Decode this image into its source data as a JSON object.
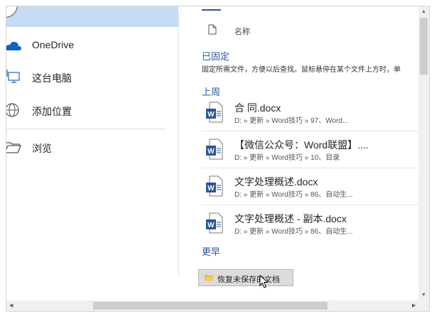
{
  "nav": {
    "items": [
      {
        "label": "OneDrive",
        "icon": "cloud-icon"
      },
      {
        "label": "这台电脑",
        "icon": "computer-icon"
      },
      {
        "label": "添加位置",
        "icon": "globe-icon"
      },
      {
        "label": "浏览",
        "icon": "folder-icon"
      }
    ]
  },
  "list": {
    "header_name": "名称",
    "pinned_title": "已固定",
    "pinned_desc": "固定所需文件，方便以后查找。鼠标悬停在某个文件上方时，单",
    "last_week_title": "上周",
    "older_title": "更早",
    "files": [
      {
        "title": "合 同.docx",
        "path": "D: » 更新 » Word技巧 » 97、Word..."
      },
      {
        "title": "【微信公众号：Word联盟】....",
        "path": "D: » 更新 » Word技巧 » 10、目录"
      },
      {
        "title": "文字处理概述.docx",
        "path": "D: » 更新 » Word技巧 » 86、自动生..."
      },
      {
        "title": "文字处理概述 - 副本.docx",
        "path": "D: » 更新 » Word技巧 » 86、自动生..."
      }
    ],
    "recover_button": "恢复未保存的文档"
  },
  "colors": {
    "accent": "#2b579a",
    "selected": "#c5dcf4",
    "word_blue": "#2b579a"
  }
}
